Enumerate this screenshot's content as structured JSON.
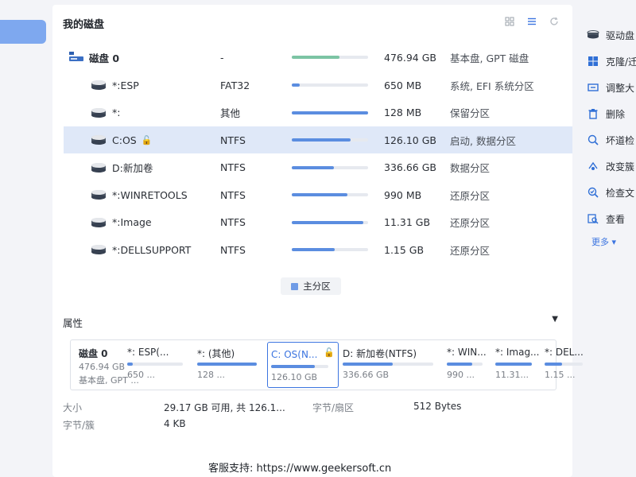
{
  "panel_title": "我的磁盘",
  "disk_row": {
    "name": "磁盘 0",
    "fs": "-",
    "size": "476.94 GB",
    "desc": "基本盘, GPT 磁盘",
    "used": 0.62
  },
  "partitions": [
    {
      "name": "*:ESP",
      "fs": "FAT32",
      "size": "650 MB",
      "desc": "系统, EFI 系统分区",
      "used": 0.1,
      "locked": false,
      "selected": false
    },
    {
      "name": "*:",
      "fs": "其他",
      "size": "128 MB",
      "desc": "保留分区",
      "used": 1.0,
      "locked": false,
      "selected": false
    },
    {
      "name": "C:OS",
      "fs": "NTFS",
      "size": "126.10 GB",
      "desc": "启动, 数据分区",
      "used": 0.77,
      "locked": true,
      "selected": true
    },
    {
      "name": "D:新加卷",
      "fs": "NTFS",
      "size": "336.66 GB",
      "desc": "数据分区",
      "used": 0.55,
      "locked": false,
      "selected": false
    },
    {
      "name": "*:WINRETOOLS",
      "fs": "NTFS",
      "size": "990 MB",
      "desc": "还原分区",
      "used": 0.73,
      "locked": false,
      "selected": false
    },
    {
      "name": "*:Image",
      "fs": "NTFS",
      "size": "11.31 GB",
      "desc": "还原分区",
      "used": 0.94,
      "locked": false,
      "selected": false
    },
    {
      "name": "*:DELLSUPPORT",
      "fs": "NTFS",
      "size": "1.15 GB",
      "desc": "还原分区",
      "used": 0.56,
      "locked": false,
      "selected": false
    }
  ],
  "legend": {
    "label": "主分区"
  },
  "properties": {
    "title": "属性",
    "disk_cell": {
      "name": "磁盘 0",
      "size": "476.94 GB",
      "type": "基本盘, GPT ..."
    },
    "cells": [
      {
        "name": "*: ESP(...",
        "size": "650 ...",
        "used": 0.1,
        "selected": false
      },
      {
        "name": "*: (其他)",
        "size": "128 ...",
        "used": 1.0,
        "selected": false
      },
      {
        "name": "C: OS(N...",
        "size": "126.10 GB",
        "used": 0.77,
        "selected": true
      },
      {
        "name": "D: 新加卷(NTFS)",
        "size": "336.66 GB",
        "used": 0.55,
        "selected": false
      },
      {
        "name": "*: WIN...",
        "size": "990 ...",
        "used": 0.7,
        "selected": false
      },
      {
        "name": "*: Imag...",
        "size": "11.31...",
        "used": 1.0,
        "selected": false
      },
      {
        "name": "*: DEL...",
        "size": "1.15 ...",
        "used": 0.45,
        "selected": false
      }
    ],
    "size_label": "大小",
    "size_value": "29.17 GB 可用, 共 126.1...",
    "bytes_per_sector_label": "字节/扇区",
    "bytes_per_sector_value": "512 Bytes",
    "bytes_per_cluster_label": "字节/簇",
    "bytes_per_cluster_value": "4 KB"
  },
  "footer_note": "客服支持: https://www.geekersoft.cn",
  "right_menu": [
    {
      "icon": "disk-icon",
      "label": "驱动盘"
    },
    {
      "icon": "windows-icon",
      "label": "克隆/迁"
    },
    {
      "icon": "resize-icon",
      "label": "调整大"
    },
    {
      "icon": "trash-icon",
      "label": "删除"
    },
    {
      "icon": "bad-sector-icon",
      "label": "坏道检"
    },
    {
      "icon": "change-icon",
      "label": "改变簇"
    },
    {
      "icon": "check-file-icon",
      "label": "检查文"
    },
    {
      "icon": "view-icon",
      "label": "查看"
    }
  ],
  "more_label": "更多 ▾",
  "colors": {
    "accent": "#3b74e0",
    "bar_fill": "#5b8de0",
    "disk_bar": "#7cc4a4",
    "selected_row": "#dfe8f8"
  }
}
